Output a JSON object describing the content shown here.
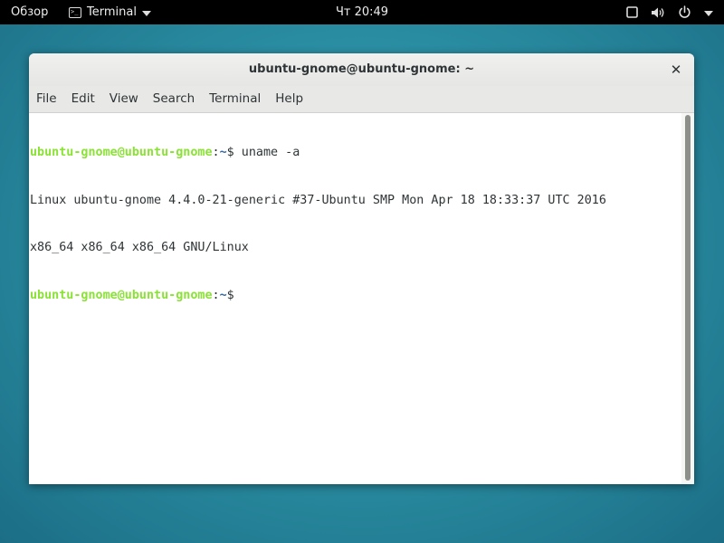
{
  "topbar": {
    "activities_label": "Обзор",
    "app_name": "Terminal",
    "clock": "Чт 20:49",
    "icons": [
      "screen-icon",
      "volume-icon",
      "power-icon",
      "chevron-down-icon"
    ]
  },
  "window": {
    "title": "ubuntu-gnome@ubuntu-gnome: ~",
    "close_glyph": "✕",
    "menu": [
      "File",
      "Edit",
      "View",
      "Search",
      "Terminal",
      "Help"
    ]
  },
  "terminal": {
    "prompt_user": "ubuntu-gnome@ubuntu-gnome",
    "prompt_sep": ":",
    "prompt_dir": "~",
    "prompt_symbol": "$",
    "command": " uname -a",
    "output_line_1": "Linux ubuntu-gnome 4.4.0-21-generic #37-Ubuntu SMP Mon Apr 18 18:33:37 UTC 2016",
    "output_line_2": "x86_64 x86_64 x86_64 GNU/Linux"
  },
  "colors": {
    "prompt_user": "#8ae234",
    "prompt_dir": "#3465a4",
    "desktop": "#2b8fa3"
  }
}
